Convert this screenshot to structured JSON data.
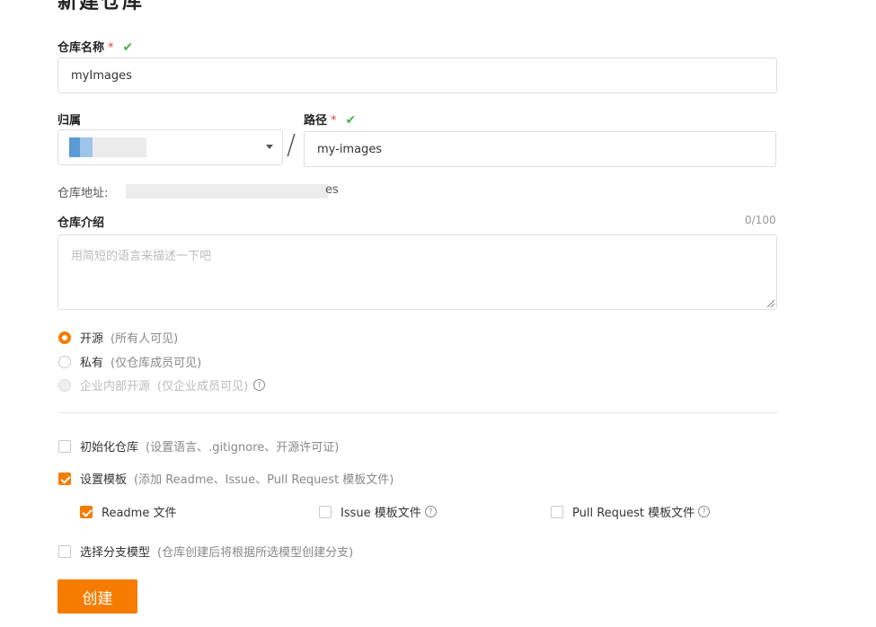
{
  "page_title": "新建仓库",
  "repo_name": {
    "label": "仓库名称",
    "required_mark": "*",
    "valid_icon": "check-icon",
    "value": "myImages"
  },
  "owner": {
    "label": "归属"
  },
  "path": {
    "label": "路径",
    "required_mark": "*",
    "valid_icon": "check-icon",
    "separator": "/",
    "value": "my-images"
  },
  "repo_address": {
    "label": "仓库地址:",
    "suffix": "es"
  },
  "description": {
    "label": "仓库介绍",
    "counter": "0/100",
    "placeholder": "用简短的语言来描述一下吧"
  },
  "visibility": {
    "options": [
      {
        "label": "开源",
        "hint": "(所有人可见)",
        "selected": true
      },
      {
        "label": "私有",
        "hint": "(仅仓库成员可见)",
        "selected": false
      },
      {
        "label": "企业内部开源",
        "hint": "(仅企业成员可见)",
        "selected": false,
        "disabled": true
      }
    ]
  },
  "init_repo": {
    "label": "初始化仓库",
    "hint": "(设置语言、.gitignore、开源许可证)",
    "checked": false
  },
  "templates": {
    "label": "设置模板",
    "hint": "(添加 Readme、Issue、Pull Request 模板文件)",
    "checked": true,
    "items": [
      {
        "label": "Readme 文件",
        "checked": true
      },
      {
        "label": "Issue 模板文件",
        "checked": false
      },
      {
        "label": "Pull Request 模板文件",
        "checked": false
      }
    ]
  },
  "branch_model": {
    "label": "选择分支模型",
    "hint": "(仓库创建后将根据所选模型创建分支)",
    "checked": false
  },
  "submit": {
    "label": "创建"
  },
  "colors": {
    "accent": "#f57c00",
    "success": "#4caf50",
    "required": "#e4393c"
  }
}
